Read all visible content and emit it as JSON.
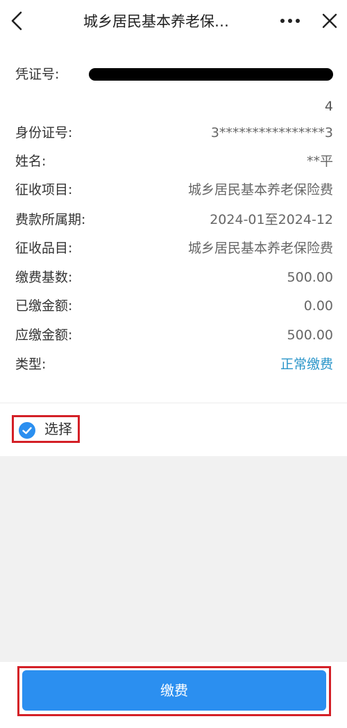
{
  "nav": {
    "title": "城乡居民基本养老保…"
  },
  "info": {
    "voucher_label": "凭证号:",
    "voucher_tail": "4",
    "rows": [
      {
        "label": "身份证号:",
        "value": "3****************3"
      },
      {
        "label": "姓名:",
        "value": "**平"
      },
      {
        "label": "征收项目:",
        "value": "城乡居民基本养老保险费"
      },
      {
        "label": "费款所属期:",
        "value": "2024-01至2024-12"
      },
      {
        "label": "征收品目:",
        "value": "城乡居民基本养老保险费"
      },
      {
        "label": "缴费基数:",
        "value": "500.00"
      },
      {
        "label": "已缴金额:",
        "value": "0.00"
      },
      {
        "label": "应缴金额:",
        "value": "500.00"
      },
      {
        "label": "类型:",
        "value": "正常缴费"
      }
    ]
  },
  "select": {
    "label": "选择",
    "checked": true
  },
  "pay": {
    "label": "缴费"
  },
  "colors": {
    "accent_blue": "#2b8ff0",
    "type_text": "#2a95c9",
    "highlight_red": "#d42027"
  }
}
